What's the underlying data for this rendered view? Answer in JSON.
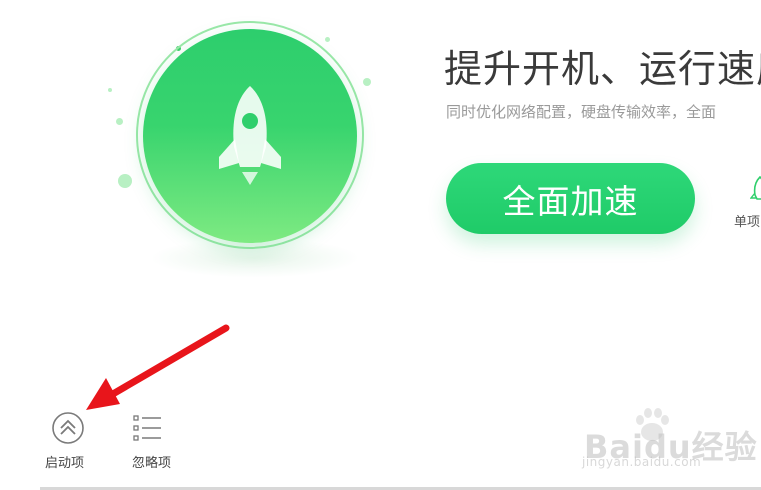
{
  "hero": {
    "title": "提升开机、运行速度",
    "subtitle": "同时优化网络配置，硬盘传输效率，全面"
  },
  "accelerate_button": {
    "label": "全面加速"
  },
  "single_item": {
    "label": "单项"
  },
  "bottom_tools": {
    "startup_label": "启动项",
    "ignore_label": "忽略项"
  },
  "watermark": {
    "text": "Baidu经验",
    "url": "jingyan.baidu.com"
  },
  "colors": {
    "accent_green": "#1fcb68",
    "arrow_red": "#e8151b"
  }
}
